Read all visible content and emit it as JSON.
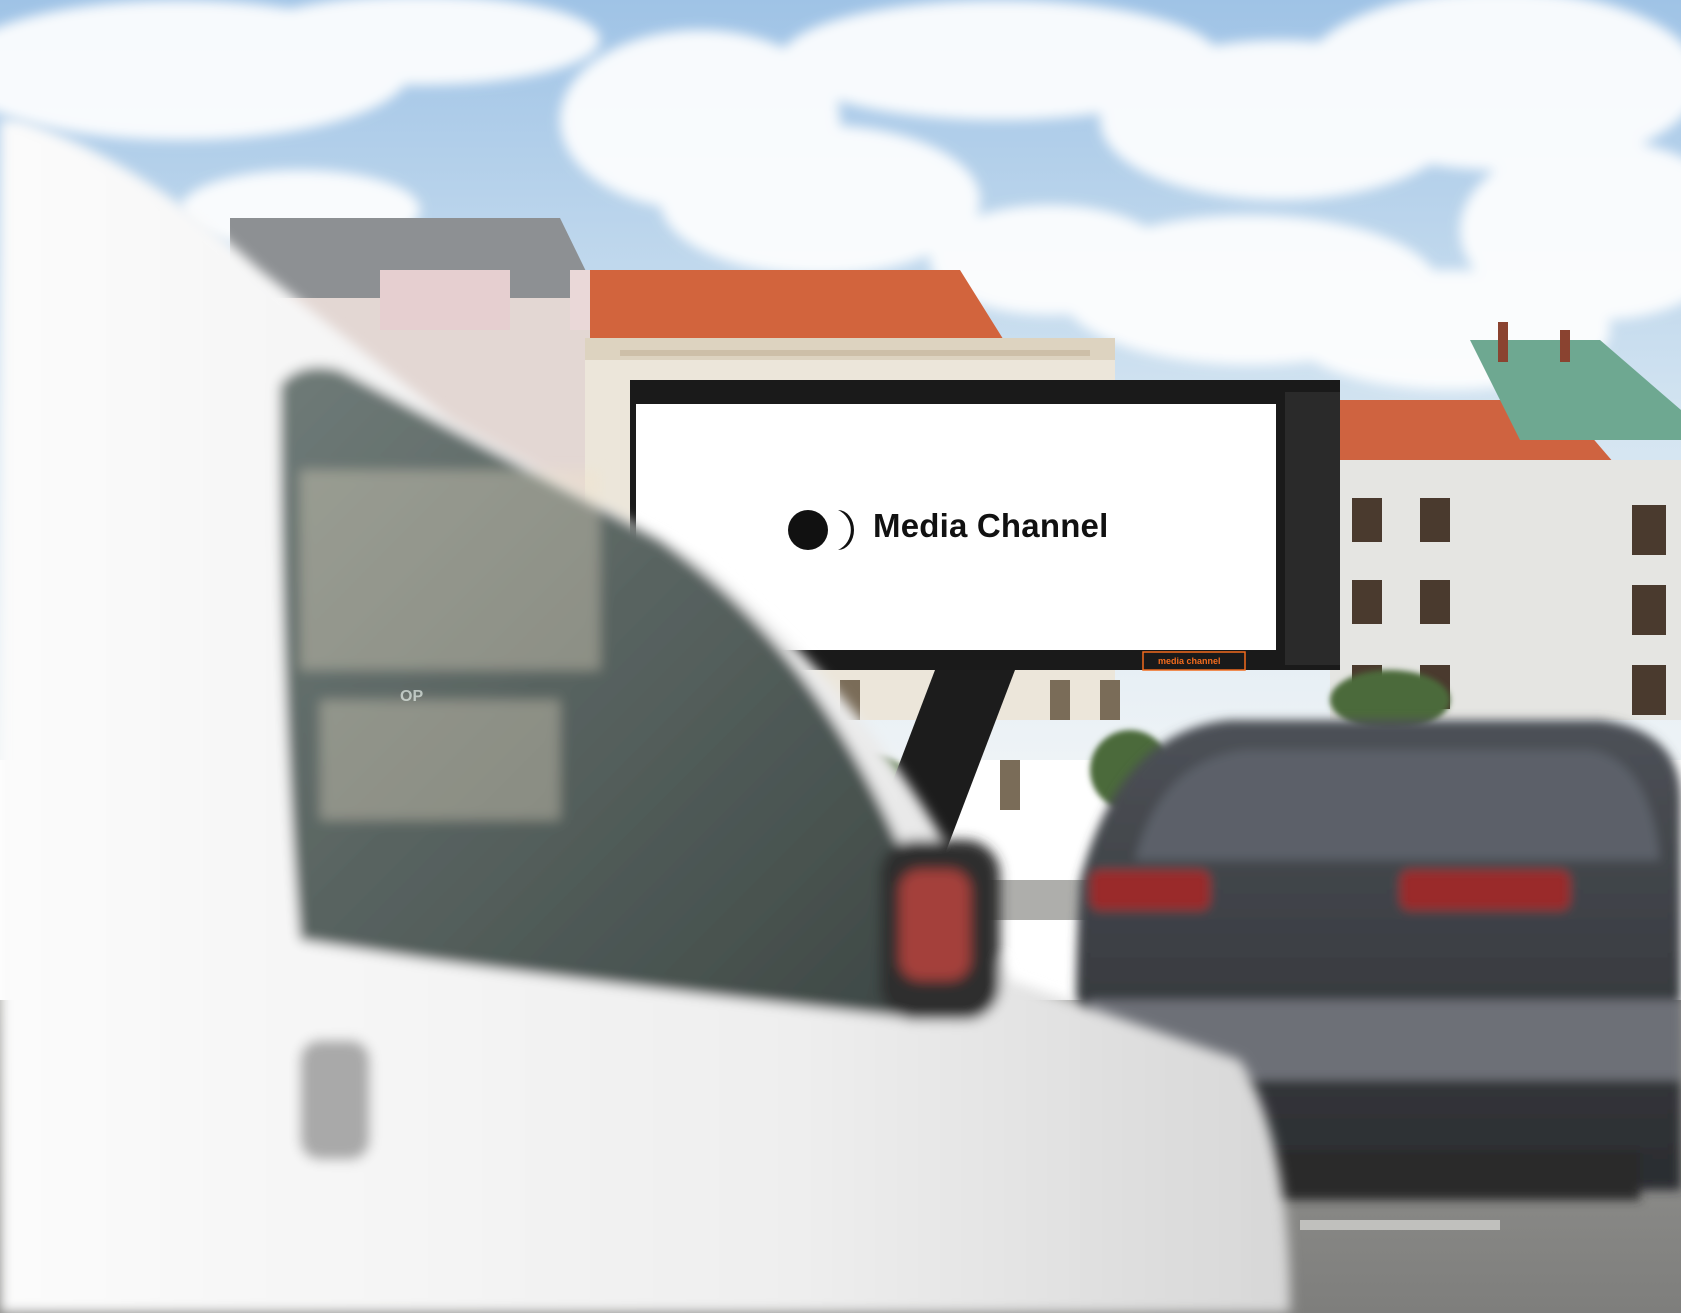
{
  "billboard": {
    "brand_name": "Media Channel",
    "logo_icon": "media-channel-logo-icon",
    "small_brand_label": "media channel"
  },
  "background": {
    "building_sign": "OP"
  },
  "colors": {
    "sky": "#c9dff0",
    "roof_orange": "#d2643d",
    "roof_green": "#6ea891",
    "building": "#e7e1d5",
    "van": "#ededed",
    "dark_car": "#3b3e43",
    "billboard_face": "#ffffff",
    "billboard_frame": "#1a1a1a",
    "brand_orange": "#f26b1d"
  }
}
